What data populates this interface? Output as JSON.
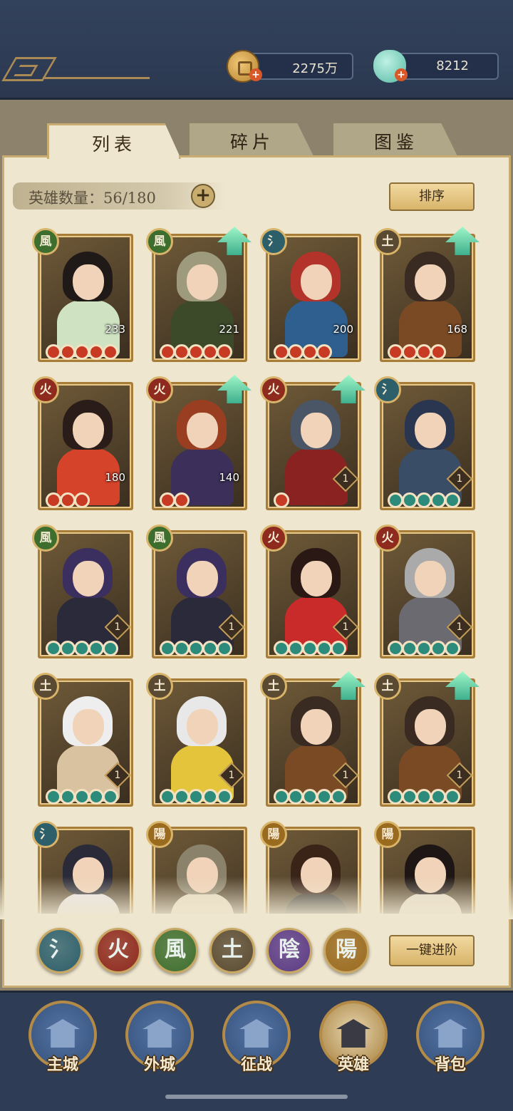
{
  "header": {
    "coins": "2275万",
    "jade": "8212"
  },
  "tabs": [
    {
      "label": "列表",
      "active": true
    },
    {
      "label": "碎片",
      "active": false
    },
    {
      "label": "图鉴",
      "active": false
    }
  ],
  "hero_count": {
    "label": "英雄数量：56/180"
  },
  "buttons": {
    "sort": "排序",
    "advance_all": "一键进阶"
  },
  "elements": {
    "water": {
      "glyph": "氵",
      "color": "#2d5f6b"
    },
    "fire": {
      "glyph": "火",
      "color": "#8e2a1e"
    },
    "wind": {
      "glyph": "風",
      "color": "#3e6e2e"
    },
    "earth": {
      "glyph": "土",
      "color": "#5a4a32"
    },
    "yin": {
      "glyph": "陰",
      "color": "#5b3b86"
    },
    "yang": {
      "glyph": "陽",
      "color": "#9a6a1e"
    }
  },
  "heroes": [
    {
      "element": "wind",
      "level": "233",
      "stars": 5,
      "star_color": "red",
      "upgrade": false
    },
    {
      "element": "wind",
      "level": "221",
      "stars": 5,
      "star_color": "red",
      "upgrade": true
    },
    {
      "element": "water",
      "level": "200",
      "stars": 4,
      "star_color": "red",
      "upgrade": false
    },
    {
      "element": "earth",
      "level": "168",
      "stars": 4,
      "star_color": "red",
      "upgrade": true
    },
    {
      "element": "fire",
      "level": "180",
      "stars": 3,
      "star_color": "red",
      "upgrade": false
    },
    {
      "element": "fire",
      "level": "140",
      "stars": 2,
      "star_color": "red",
      "upgrade": true
    },
    {
      "element": "fire",
      "level": "1",
      "stars": 1,
      "star_color": "red",
      "upgrade": true
    },
    {
      "element": "water",
      "level": "1",
      "stars": 5,
      "star_color": "green",
      "upgrade": false
    },
    {
      "element": "wind",
      "level": "1",
      "stars": 5,
      "star_color": "green",
      "upgrade": false
    },
    {
      "element": "wind",
      "level": "1",
      "stars": 5,
      "star_color": "green",
      "upgrade": false
    },
    {
      "element": "fire",
      "level": "1",
      "stars": 5,
      "star_color": "green",
      "upgrade": false
    },
    {
      "element": "fire",
      "level": "1",
      "stars": 5,
      "star_color": "green",
      "upgrade": false
    },
    {
      "element": "earth",
      "level": "1",
      "stars": 5,
      "star_color": "green",
      "upgrade": false
    },
    {
      "element": "earth",
      "level": "1",
      "stars": 5,
      "star_color": "green",
      "upgrade": false
    },
    {
      "element": "earth",
      "level": "1",
      "stars": 5,
      "star_color": "green",
      "upgrade": true
    },
    {
      "element": "earth",
      "level": "1",
      "stars": 5,
      "star_color": "green",
      "upgrade": true
    },
    {
      "element": "water",
      "level": "",
      "stars": 0,
      "star_color": "green",
      "upgrade": false
    },
    {
      "element": "yang",
      "level": "",
      "stars": 0,
      "star_color": "green",
      "upgrade": false
    },
    {
      "element": "yang",
      "level": "",
      "stars": 0,
      "star_color": "green",
      "upgrade": false
    },
    {
      "element": "yang",
      "level": "",
      "stars": 0,
      "star_color": "green",
      "upgrade": false
    }
  ],
  "hero_palette": [
    {
      "hair": "#1f1a18",
      "body": "#cfe3c2"
    },
    {
      "hair": "#9e9a7e",
      "body": "#3d4a2a"
    },
    {
      "hair": "#b3322a",
      "body": "#2e5f8f"
    },
    {
      "hair": "#3a2b22",
      "body": "#7a4a24"
    },
    {
      "hair": "#2a1c18",
      "body": "#d5442a"
    },
    {
      "hair": "#9a3e22",
      "body": "#3c2f5a"
    },
    {
      "hair": "#4a5566",
      "body": "#8a2222"
    },
    {
      "hair": "#2a3550",
      "body": "#3a4d66"
    },
    {
      "hair": "#3a2f5e",
      "body": "#2a2a3a"
    },
    {
      "hair": "#3a2f5e",
      "body": "#2a2a3a"
    },
    {
      "hair": "#2a1814",
      "body": "#c92a2a"
    },
    {
      "hair": "#aaaaaa",
      "body": "#6a6a70"
    },
    {
      "hair": "#eeeeee",
      "body": "#d9c2a0"
    },
    {
      "hair": "#e8e8e8",
      "body": "#e4c43a"
    },
    {
      "hair": "#3a2b22",
      "body": "#7a4a24"
    },
    {
      "hair": "#3a2b22",
      "body": "#7a4a24"
    },
    {
      "hair": "#2a2a38",
      "body": "#e8e6ea"
    },
    {
      "hair": "#8a826a",
      "body": "#e7dcc2"
    },
    {
      "hair": "#3a2418",
      "body": "#2a2a26"
    },
    {
      "hair": "#1e1614",
      "body": "#e6dcc8"
    }
  ],
  "filters": [
    "water",
    "fire",
    "wind",
    "earth",
    "yin",
    "yang"
  ],
  "nav": [
    {
      "label": "主城",
      "active": false
    },
    {
      "label": "外城",
      "active": false
    },
    {
      "label": "征战",
      "active": false
    },
    {
      "label": "英雄",
      "active": true
    },
    {
      "label": "背包",
      "active": false
    }
  ]
}
